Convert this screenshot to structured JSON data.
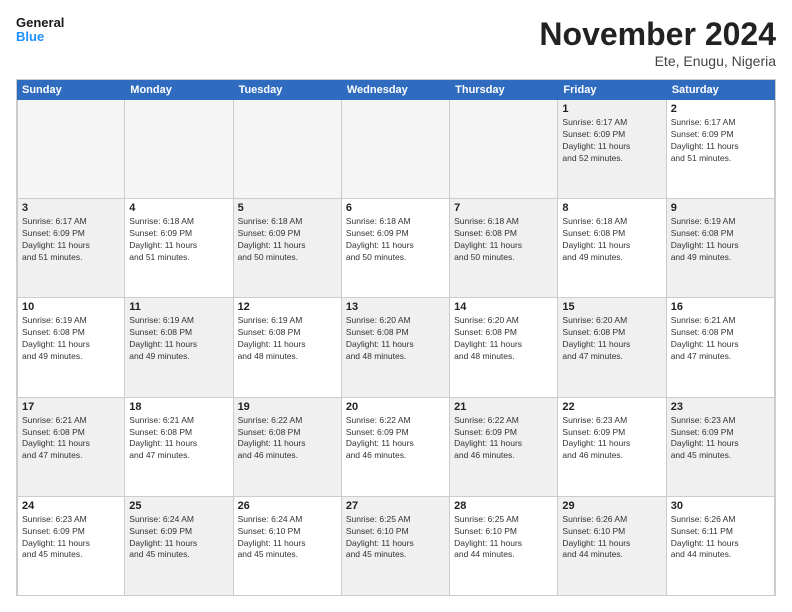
{
  "logo": {
    "line1": "General",
    "line2": "Blue"
  },
  "title": "November 2024",
  "location": "Ete, Enugu, Nigeria",
  "days_header": [
    "Sunday",
    "Monday",
    "Tuesday",
    "Wednesday",
    "Thursday",
    "Friday",
    "Saturday"
  ],
  "weeks": [
    [
      {
        "day": "",
        "info": "",
        "empty": true
      },
      {
        "day": "",
        "info": "",
        "empty": true
      },
      {
        "day": "",
        "info": "",
        "empty": true
      },
      {
        "day": "",
        "info": "",
        "empty": true
      },
      {
        "day": "",
        "info": "",
        "empty": true
      },
      {
        "day": "1",
        "info": "Sunrise: 6:17 AM\nSunset: 6:09 PM\nDaylight: 11 hours\nand 52 minutes.",
        "empty": false
      },
      {
        "day": "2",
        "info": "Sunrise: 6:17 AM\nSunset: 6:09 PM\nDaylight: 11 hours\nand 51 minutes.",
        "empty": false
      }
    ],
    [
      {
        "day": "3",
        "info": "Sunrise: 6:17 AM\nSunset: 6:09 PM\nDaylight: 11 hours\nand 51 minutes.",
        "empty": false
      },
      {
        "day": "4",
        "info": "Sunrise: 6:18 AM\nSunset: 6:09 PM\nDaylight: 11 hours\nand 51 minutes.",
        "empty": false
      },
      {
        "day": "5",
        "info": "Sunrise: 6:18 AM\nSunset: 6:09 PM\nDaylight: 11 hours\nand 50 minutes.",
        "empty": false
      },
      {
        "day": "6",
        "info": "Sunrise: 6:18 AM\nSunset: 6:09 PM\nDaylight: 11 hours\nand 50 minutes.",
        "empty": false
      },
      {
        "day": "7",
        "info": "Sunrise: 6:18 AM\nSunset: 6:08 PM\nDaylight: 11 hours\nand 50 minutes.",
        "empty": false
      },
      {
        "day": "8",
        "info": "Sunrise: 6:18 AM\nSunset: 6:08 PM\nDaylight: 11 hours\nand 49 minutes.",
        "empty": false
      },
      {
        "day": "9",
        "info": "Sunrise: 6:19 AM\nSunset: 6:08 PM\nDaylight: 11 hours\nand 49 minutes.",
        "empty": false
      }
    ],
    [
      {
        "day": "10",
        "info": "Sunrise: 6:19 AM\nSunset: 6:08 PM\nDaylight: 11 hours\nand 49 minutes.",
        "empty": false
      },
      {
        "day": "11",
        "info": "Sunrise: 6:19 AM\nSunset: 6:08 PM\nDaylight: 11 hours\nand 49 minutes.",
        "empty": false
      },
      {
        "day": "12",
        "info": "Sunrise: 6:19 AM\nSunset: 6:08 PM\nDaylight: 11 hours\nand 48 minutes.",
        "empty": false
      },
      {
        "day": "13",
        "info": "Sunrise: 6:20 AM\nSunset: 6:08 PM\nDaylight: 11 hours\nand 48 minutes.",
        "empty": false
      },
      {
        "day": "14",
        "info": "Sunrise: 6:20 AM\nSunset: 6:08 PM\nDaylight: 11 hours\nand 48 minutes.",
        "empty": false
      },
      {
        "day": "15",
        "info": "Sunrise: 6:20 AM\nSunset: 6:08 PM\nDaylight: 11 hours\nand 47 minutes.",
        "empty": false
      },
      {
        "day": "16",
        "info": "Sunrise: 6:21 AM\nSunset: 6:08 PM\nDaylight: 11 hours\nand 47 minutes.",
        "empty": false
      }
    ],
    [
      {
        "day": "17",
        "info": "Sunrise: 6:21 AM\nSunset: 6:08 PM\nDaylight: 11 hours\nand 47 minutes.",
        "empty": false
      },
      {
        "day": "18",
        "info": "Sunrise: 6:21 AM\nSunset: 6:08 PM\nDaylight: 11 hours\nand 47 minutes.",
        "empty": false
      },
      {
        "day": "19",
        "info": "Sunrise: 6:22 AM\nSunset: 6:08 PM\nDaylight: 11 hours\nand 46 minutes.",
        "empty": false
      },
      {
        "day": "20",
        "info": "Sunrise: 6:22 AM\nSunset: 6:09 PM\nDaylight: 11 hours\nand 46 minutes.",
        "empty": false
      },
      {
        "day": "21",
        "info": "Sunrise: 6:22 AM\nSunset: 6:09 PM\nDaylight: 11 hours\nand 46 minutes.",
        "empty": false
      },
      {
        "day": "22",
        "info": "Sunrise: 6:23 AM\nSunset: 6:09 PM\nDaylight: 11 hours\nand 46 minutes.",
        "empty": false
      },
      {
        "day": "23",
        "info": "Sunrise: 6:23 AM\nSunset: 6:09 PM\nDaylight: 11 hours\nand 45 minutes.",
        "empty": false
      }
    ],
    [
      {
        "day": "24",
        "info": "Sunrise: 6:23 AM\nSunset: 6:09 PM\nDaylight: 11 hours\nand 45 minutes.",
        "empty": false
      },
      {
        "day": "25",
        "info": "Sunrise: 6:24 AM\nSunset: 6:09 PM\nDaylight: 11 hours\nand 45 minutes.",
        "empty": false
      },
      {
        "day": "26",
        "info": "Sunrise: 6:24 AM\nSunset: 6:10 PM\nDaylight: 11 hours\nand 45 minutes.",
        "empty": false
      },
      {
        "day": "27",
        "info": "Sunrise: 6:25 AM\nSunset: 6:10 PM\nDaylight: 11 hours\nand 45 minutes.",
        "empty": false
      },
      {
        "day": "28",
        "info": "Sunrise: 6:25 AM\nSunset: 6:10 PM\nDaylight: 11 hours\nand 44 minutes.",
        "empty": false
      },
      {
        "day": "29",
        "info": "Sunrise: 6:26 AM\nSunset: 6:10 PM\nDaylight: 11 hours\nand 44 minutes.",
        "empty": false
      },
      {
        "day": "30",
        "info": "Sunrise: 6:26 AM\nSunset: 6:11 PM\nDaylight: 11 hours\nand 44 minutes.",
        "empty": false
      }
    ]
  ]
}
